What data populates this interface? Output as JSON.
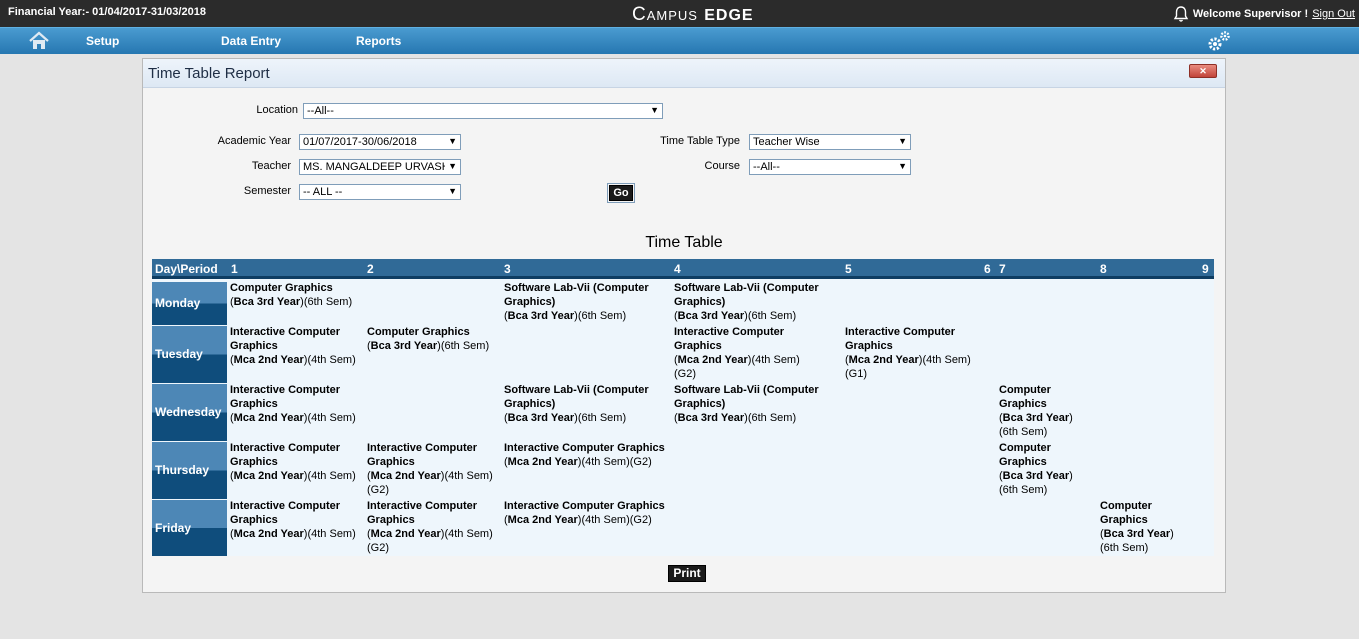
{
  "topbar": {
    "financial_year": "Financial Year:- 01/04/2017-31/03/2018",
    "logo_part1": "Campus ",
    "logo_part2": "EDGE",
    "welcome": "Welcome Supervisor !",
    "sign_out": "Sign Out"
  },
  "nav": {
    "items": [
      "Setup",
      "Data Entry",
      "Reports"
    ]
  },
  "panel": {
    "title": "Time Table Report",
    "close": "✕"
  },
  "form": {
    "location_label": "Location",
    "location_value": "--All--",
    "academic_year_label": "Academic Year",
    "academic_year_value": "01/07/2017-30/06/2018",
    "teacher_label": "Teacher",
    "teacher_value": "MS. MANGALDEEP URVASHI",
    "semester_label": "Semester",
    "semester_value": "-- ALL --",
    "tt_type_label": "Time Table Type",
    "tt_type_value": "Teacher Wise",
    "course_label": "Course",
    "course_value": "--All--",
    "go": "Go"
  },
  "timetable": {
    "title": "Time Table",
    "header": {
      "day_period": "Day\\Period",
      "periods": [
        "1",
        "2",
        "3",
        "4",
        "5",
        "6",
        "7",
        "8",
        "9"
      ]
    },
    "days": [
      "Monday",
      "Tuesday",
      "Wednesday",
      "Thursday",
      "Friday"
    ],
    "entries": {
      "mon_p1": {
        "subject": "Computer Graphics",
        "class": "Bca 3rd Year",
        "sem": "(6th Sem)",
        "group": ""
      },
      "mon_p3": {
        "subject": "Software Lab-Vii (Computer Graphics)",
        "class": "Bca 3rd Year",
        "sem": "(6th Sem)",
        "group": ""
      },
      "mon_p4": {
        "subject": "Software Lab-Vii (Computer Graphics)",
        "class": "Bca 3rd Year",
        "sem": "(6th Sem)",
        "group": ""
      },
      "tue_p1": {
        "subject": "Interactive Computer Graphics",
        "class": "Mca 2nd Year",
        "sem": "(4th Sem)",
        "group": ""
      },
      "tue_p2": {
        "subject": "Computer Graphics",
        "class": "Bca 3rd Year",
        "sem": "(6th Sem)",
        "group": ""
      },
      "tue_p4": {
        "subject": "Interactive Computer Graphics",
        "class": "Mca 2nd Year",
        "sem": "(4th Sem)",
        "group": "(G2)"
      },
      "tue_p5": {
        "subject": "Interactive Computer Graphics",
        "class": "Mca 2nd Year",
        "sem": "(4th Sem)",
        "group": "(G1)"
      },
      "wed_p1": {
        "subject": "Interactive Computer Graphics",
        "class": "Mca 2nd Year",
        "sem": "(4th Sem)",
        "group": ""
      },
      "wed_p3": {
        "subject": "Software Lab-Vii (Computer Graphics)",
        "class": "Bca 3rd Year",
        "sem": "(6th Sem)",
        "group": ""
      },
      "wed_p4": {
        "subject": "Software Lab-Vii (Computer Graphics)",
        "class": "Bca 3rd Year",
        "sem": "(6th Sem)",
        "group": ""
      },
      "wed_p7": {
        "subject": "Computer Graphics",
        "class": "Bca 3rd Year",
        "sem": "(6th Sem)",
        "group": ""
      },
      "thu_p1": {
        "subject": "Interactive Computer Graphics",
        "class": "Mca 2nd Year",
        "sem": "(4th Sem)",
        "group": ""
      },
      "thu_p2": {
        "subject": "Interactive Computer Graphics",
        "class": "Mca 2nd Year",
        "sem": "(4th Sem)",
        "group": "(G2)"
      },
      "thu_p3": {
        "subject": "Interactive Computer Graphics",
        "class": "Mca 2nd Year",
        "sem": "(4th Sem)",
        "group": "(G2)"
      },
      "thu_p7": {
        "subject": "Computer Graphics",
        "class": "Bca 3rd Year",
        "sem": "(6th Sem)",
        "group": ""
      },
      "fri_p1": {
        "subject": "Interactive Computer Graphics",
        "class": "Mca 2nd Year",
        "sem": "(4th Sem)",
        "group": ""
      },
      "fri_p2": {
        "subject": "Interactive Computer Graphics",
        "class": "Mca 2nd Year",
        "sem": "(4th Sem)",
        "group": "(G2)"
      },
      "fri_p3": {
        "subject": "Interactive Computer Graphics",
        "class": "Mca 2nd Year",
        "sem": "(4th Sem)",
        "group": "(G2)"
      },
      "fri_p8": {
        "subject": "Computer Graphics",
        "class": "Bca 3rd Year",
        "sem": "(6th Sem)",
        "group": ""
      }
    }
  },
  "print": "Print",
  "colors": {
    "topbar": "#2b2b2b",
    "nav": "#2677b1",
    "table_header": "#306a97",
    "day_cell_dark": "#0f4d7c",
    "table_body": "#eef6fc"
  }
}
